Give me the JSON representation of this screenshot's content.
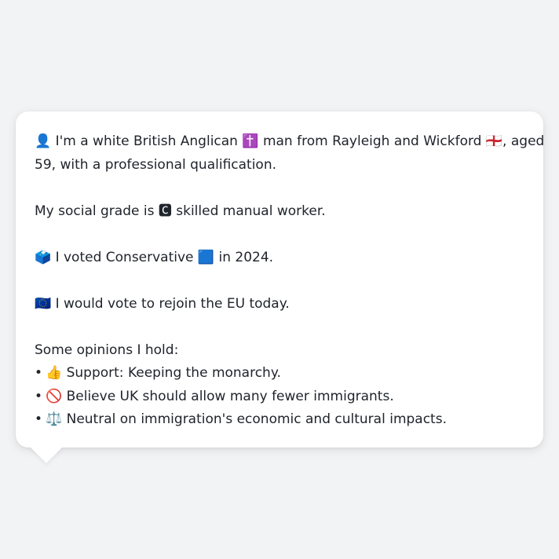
{
  "identity": {
    "person_emoji": "👤",
    "text_a": " I'm a white British Anglican ",
    "religion_emoji": "✝️",
    "text_b": " man from Rayleigh and Wickford ",
    "flag_emoji": "🏴󠁧󠁢󠁥󠁮󠁧󠁿",
    "text_c": ", aged",
    "line2": "59, with a professional qualification."
  },
  "social_grade": {
    "text_a": "My social grade is ",
    "grade_emoji": "🅲",
    "text_b": " skilled manual worker."
  },
  "vote": {
    "ballot_emoji": "🗳️",
    "text_a": " I voted Conservative ",
    "party_emoji": "🟦",
    "text_b": " in 2024."
  },
  "eu": {
    "eu_emoji": "🇪🇺",
    "text": " I would vote to rejoin the EU today."
  },
  "opinions": {
    "heading": "Some opinions I hold:",
    "bullet": "•",
    "items": [
      {
        "emoji": "👍",
        "text": " Support: Keeping the monarchy."
      },
      {
        "emoji": "🚫",
        "text": " Believe UK should allow many fewer immigrants."
      },
      {
        "emoji": "⚖️",
        "text": " Neutral on immigration's economic and cultural impacts."
      }
    ]
  }
}
